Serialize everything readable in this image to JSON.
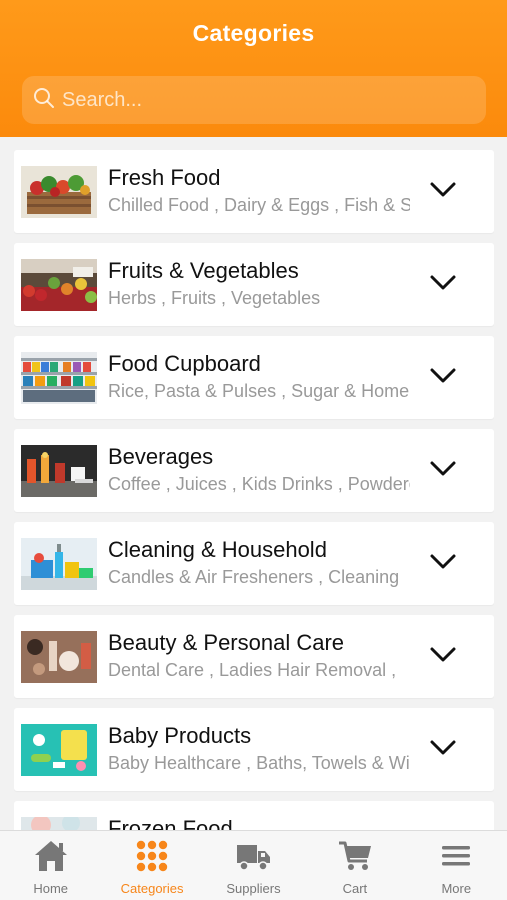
{
  "header": {
    "title": "Categories"
  },
  "search": {
    "placeholder": "Search...",
    "icon": "search-icon"
  },
  "categories": [
    {
      "name": "Fresh Food",
      "subs": "Chilled Food ,  Dairy & Eggs ,  Fish & Seafood"
    },
    {
      "name": "Fruits & Vegetables",
      "subs": "Herbs ,  Fruits ,  Vegetables"
    },
    {
      "name": "Food Cupboard",
      "subs": "Rice, Pasta & Pulses ,  Sugar & Home Baking"
    },
    {
      "name": "Beverages",
      "subs": "Coffee ,  Juices ,  Kids Drinks ,  Powdered Drinks"
    },
    {
      "name": "Cleaning & Household",
      "subs": "Candles & Air Fresheners ,  Cleaning"
    },
    {
      "name": "Beauty & Personal Care",
      "subs": "Dental Care ,  Ladies Hair Removal ,"
    },
    {
      "name": "Baby Products",
      "subs": "Baby Healthcare ,  Baths, Towels & Wipes"
    },
    {
      "name": "Frozen Food",
      "subs": ""
    }
  ],
  "tabbar": {
    "items": [
      {
        "label": "Home",
        "icon": "home-icon"
      },
      {
        "label": "Categories",
        "icon": "grid-icon",
        "active": true
      },
      {
        "label": "Suppliers",
        "icon": "truck-icon"
      },
      {
        "label": "Cart",
        "icon": "cart-icon"
      },
      {
        "label": "More",
        "icon": "menu-icon"
      }
    ]
  },
  "colors": {
    "accent": "#f7861a",
    "header": "#fb8a0c",
    "inactive": "#777777"
  }
}
